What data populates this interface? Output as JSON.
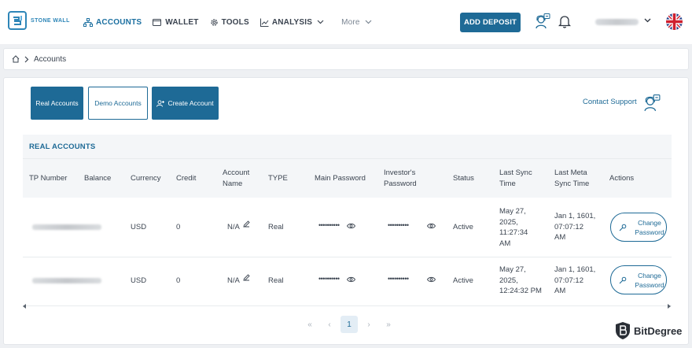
{
  "header": {
    "logo_text": "STONE WALL",
    "nav": [
      {
        "label": "ACCOUNTS",
        "icon": "sitemap-icon"
      },
      {
        "label": "WALLET",
        "icon": "wallet-icon"
      },
      {
        "label": "TOOLS",
        "icon": "gear-icon"
      },
      {
        "label": "ANALYSIS",
        "icon": "chart-icon"
      }
    ],
    "more_label": "More",
    "deposit_label": "ADD DEPOSIT",
    "accent": "#1e6a96"
  },
  "breadcrumb": {
    "current": "Accounts"
  },
  "tabs": {
    "real": "Real Accounts",
    "demo": "Demo Accounts",
    "create": "Create Account"
  },
  "contact_support": "Contact Support",
  "table": {
    "title": "REAL ACCOUNTS",
    "headers": {
      "tp": "TP Number",
      "balance": "Balance",
      "currency": "Currency",
      "credit": "Credit",
      "account_name_1": "Account",
      "account_name_2": "Name",
      "type": "TYPE",
      "main_password": "Main Password",
      "investor_1": "Investor's",
      "investor_2": "Password",
      "status": "Status",
      "last_sync_1": "Last Sync",
      "last_sync_2": "Time",
      "last_meta_1": "Last Meta",
      "last_meta_2": "Sync Time",
      "actions": "Actions"
    },
    "rows": [
      {
        "currency": "USD",
        "credit": "0",
        "account_name": "N/A",
        "type": "Real",
        "main_password": "••••••••••",
        "investor_password": "••••••••••",
        "status": "Active",
        "last_sync": [
          "May 27,",
          "2025,",
          "11:27:34",
          "AM"
        ],
        "last_meta": [
          "Jan 1, 1601,",
          "07:07:12",
          "AM"
        ],
        "action": [
          "Change",
          "Password"
        ]
      },
      {
        "currency": "USD",
        "credit": "0",
        "account_name": "N/A",
        "type": "Real",
        "main_password": "••••••••••",
        "investor_password": "••••••••••",
        "status": "Active",
        "last_sync": [
          "May 27,",
          "2025,",
          "12:24:32 PM"
        ],
        "last_meta": [
          "Jan 1, 1601,",
          "07:07:12",
          "AM"
        ],
        "action": [
          "Change",
          "Password"
        ]
      }
    ]
  },
  "pagination": {
    "first": "«",
    "prev": "‹",
    "current": "1",
    "next": "›",
    "last": "»"
  },
  "watermark": "BitDegree"
}
